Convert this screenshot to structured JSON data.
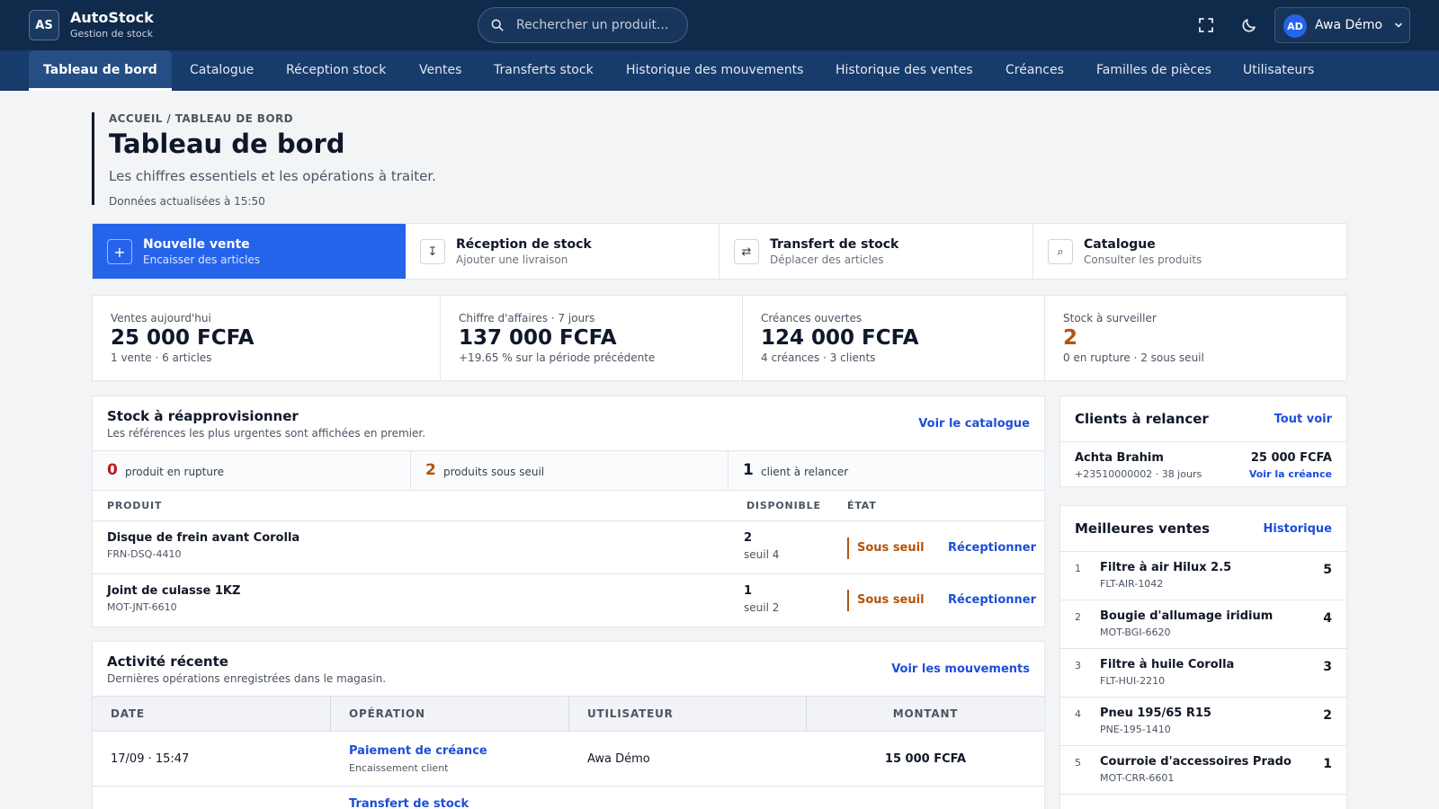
{
  "app": {
    "logo": "AS",
    "name": "AutoStock",
    "subtitle": "Gestion de stock"
  },
  "search": {
    "placeholder": "Rechercher un produit..."
  },
  "topbar": {
    "fullscreen_icon": "fullscreen-icon",
    "theme_icon": "moon-icon"
  },
  "user": {
    "initials": "AD",
    "name": "Awa Démo"
  },
  "nav": [
    {
      "label": "Tableau de bord",
      "active": true
    },
    {
      "label": "Catalogue"
    },
    {
      "label": "Réception stock"
    },
    {
      "label": "Ventes"
    },
    {
      "label": "Transferts stock"
    },
    {
      "label": "Historique des mouvements"
    },
    {
      "label": "Historique des ventes"
    },
    {
      "label": "Créances"
    },
    {
      "label": "Familles de pièces"
    },
    {
      "label": "Utilisateurs"
    }
  ],
  "header": {
    "breadcrumb": "ACCUEIL / TABLEAU DE BORD",
    "title": "Tableau de bord",
    "subtitle": "Les chiffres essentiels et les opérations à traiter.",
    "updated": "Données actualisées à 15:50"
  },
  "quick_actions": [
    {
      "icon": "+",
      "title": "Nouvelle vente",
      "sub": "Encaisser des articles",
      "primary": true
    },
    {
      "icon": "↧",
      "title": "Réception de stock",
      "sub": "Ajouter une livraison"
    },
    {
      "icon": "⇄",
      "title": "Transfert de stock",
      "sub": "Déplacer des articles"
    },
    {
      "icon": "⌕",
      "title": "Catalogue",
      "sub": "Consulter les produits"
    }
  ],
  "kpis": [
    {
      "label": "Ventes aujourd'hui",
      "value": "25 000 FCFA",
      "foot": "1 vente · 6 articles"
    },
    {
      "label": "Chiffre d'affaires · 7 jours",
      "value": "137 000 FCFA",
      "foot": "+19.65 % sur la période précédente"
    },
    {
      "label": "Créances ouvertes",
      "value": "124 000 FCFA",
      "foot": "4 créances · 3 clients"
    },
    {
      "label": "Stock à surveiller",
      "value": "2",
      "foot": "0 en rupture · 2 sous seuil"
    }
  ],
  "restock": {
    "title": "Stock à réapprovisionner",
    "subtitle": "Les références les plus urgentes sont affichées en premier.",
    "link": "Voir le catalogue",
    "stats": [
      {
        "num": "0",
        "text": "produit en rupture",
        "color": "#b91c1c"
      },
      {
        "num": "2",
        "text": "produits sous seuil",
        "color": "#b45309"
      },
      {
        "num": "1",
        "text": "client à relancer",
        "color": "#111827"
      }
    ],
    "columns": {
      "product": "PRODUIT",
      "available": "DISPONIBLE",
      "state": "ÉTAT"
    },
    "rows": [
      {
        "name": "Disque de frein avant Corolla",
        "sku": "FRN-DSQ-4410",
        "available": "2",
        "threshold": "seuil 4",
        "state": "Sous seuil",
        "action": "Réceptionner"
      },
      {
        "name": "Joint de culasse 1KZ",
        "sku": "MOT-JNT-6610",
        "available": "1",
        "threshold": "seuil 2",
        "state": "Sous seuil",
        "action": "Réceptionner"
      }
    ]
  },
  "activity": {
    "title": "Activité récente",
    "subtitle": "Dernières opérations enregistrées dans le magasin.",
    "link": "Voir les mouvements",
    "columns": {
      "date": "DATE",
      "operation": "OPÉRATION",
      "user": "UTILISATEUR",
      "amount": "MONTANT"
    },
    "rows": [
      {
        "date": "17/09 · 15:47",
        "operation": "Paiement de créance",
        "detail": "Encaissement client",
        "user": "Awa Démo",
        "amount": "15 000 FCFA"
      },
      {
        "operation": "Transfert de stock"
      }
    ]
  },
  "clients": {
    "title": "Clients à relancer",
    "link": "Tout voir",
    "items": [
      {
        "name": "Achta Brahim",
        "meta": "+23510000002 · 38 jours",
        "amount": "25 000 FCFA",
        "action": "Voir la créance"
      }
    ]
  },
  "best_sellers": {
    "title": "Meilleures ventes",
    "link": "Historique",
    "items": [
      {
        "rank": "1",
        "name": "Filtre à air Hilux 2.5",
        "sku": "FLT-AIR-1042",
        "qty": "5"
      },
      {
        "rank": "2",
        "name": "Bougie d'allumage iridium",
        "sku": "MOT-BGI-6620",
        "qty": "4"
      },
      {
        "rank": "3",
        "name": "Filtre à huile Corolla",
        "sku": "FLT-HUI-2210",
        "qty": "3"
      },
      {
        "rank": "4",
        "name": "Pneu 195/65 R15",
        "sku": "PNE-195-1410",
        "qty": "2"
      },
      {
        "rank": "5",
        "name": "Courroie d'accessoires Prado",
        "sku": "MOT-CRR-6601",
        "qty": "1"
      }
    ]
  }
}
